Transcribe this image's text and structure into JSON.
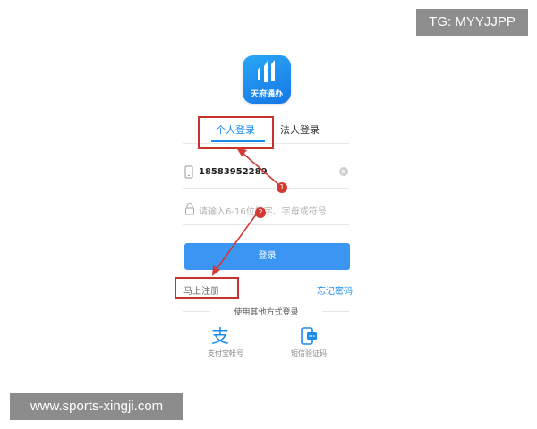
{
  "watermarks": {
    "tg": "TG: MYYJJPP",
    "site": "www.sports-xingji.com"
  },
  "app": {
    "logo_name": "天府通办"
  },
  "tabs": {
    "personal": "个人登录",
    "legal": "法人登录",
    "active": "personal"
  },
  "form": {
    "phone_value": "18583952289",
    "password_placeholder": "请输入6-16位数字、字母或符号",
    "login_button": "登录",
    "register_link": "马上注册",
    "forgot_link": "忘记密码"
  },
  "other_login": {
    "title": "使用其他方式登录",
    "options": [
      {
        "label": "支付宝帐号",
        "icon": "alipay-icon"
      },
      {
        "label": "短信验证码",
        "icon": "sms-icon"
      }
    ]
  },
  "annotations": {
    "markers": [
      "1",
      "2"
    ]
  },
  "colors": {
    "accent": "#1a8cf0",
    "button": "#3a96f2",
    "highlight": "#c8322d"
  }
}
